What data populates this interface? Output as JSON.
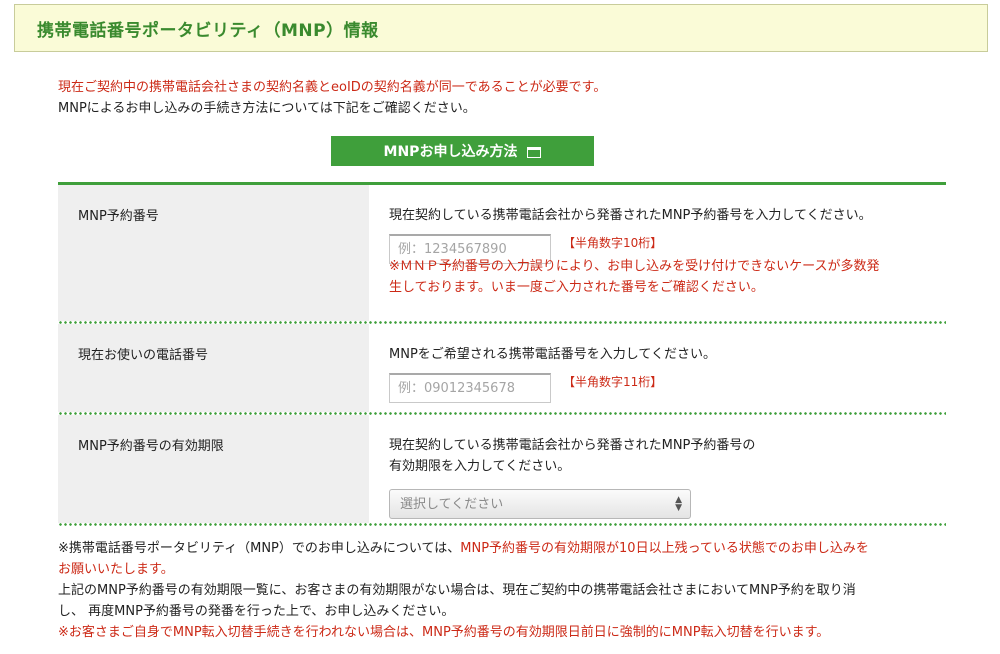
{
  "header": {
    "title": "携帯電話番号ポータビリティ（MNP）情報"
  },
  "intro": {
    "line1": "現在ご契約中の携帯電話会社さまの契約名義とeoIDの契約名義が同一であることが必要です。",
    "line2": "MNPによるお申し込みの手続き方法については下記をご確認ください。"
  },
  "mnp_button": {
    "label": "MNPお申し込み方法",
    "icon": "new-window-icon"
  },
  "form": {
    "reservation_number": {
      "label": "MNP予約番号",
      "description": "現在契約している携帯電話会社から発番されたMNP予約番号を入力してください。",
      "placeholder": "例：1234567890",
      "value": "",
      "hint": "【半角数字10桁】",
      "warning_line1": "※ＭＮＰ予約番号の入力誤りにより、お申し込みを受け付けできないケースが多数発",
      "warning_line2": "生しております。いま一度ご入力された番号をご確認ください。"
    },
    "phone_number": {
      "label": "現在お使いの電話番号",
      "description": "MNPをご希望される携帯電話番号を入力してください。",
      "placeholder": "例：09012345678",
      "value": "",
      "hint": "【半角数字11桁】"
    },
    "expiry": {
      "label": "MNP予約番号の有効期限",
      "description_line1": "現在契約している携帯電話会社から発番されたMNP予約番号の",
      "description_line2": "有効期限を入力してください。",
      "select_value": "選択してください"
    }
  },
  "footer": {
    "note1_black": "※携帯電話番号ポータビリティ（MNP）でのお申し込みについては、",
    "note1_red_a": "MNP予約番号の有効期限が10日以上残っている状態でのお申し込みを",
    "note1_red_b": "お願いいたします。",
    "note2_line1": "上記のMNP予約番号の有効期限一覧に、お客さまの有効期限がない場合は、現在ご契約中の携帯電話会社さまにおいてMNP予約を取り消",
    "note2_line2": "し、 再度MNP予約番号の発番を行った上で、お申し込みください。",
    "note3": "※お客さまご自身でMNP転入切替手続きを行われない場合は、MNP予約番号の有効期限日前日に強制的にMNP転入切替を行います。"
  },
  "colors": {
    "accent_green": "#3f9f3b",
    "warning_red": "#cc2a17",
    "header_bg": "#fafbd7"
  }
}
